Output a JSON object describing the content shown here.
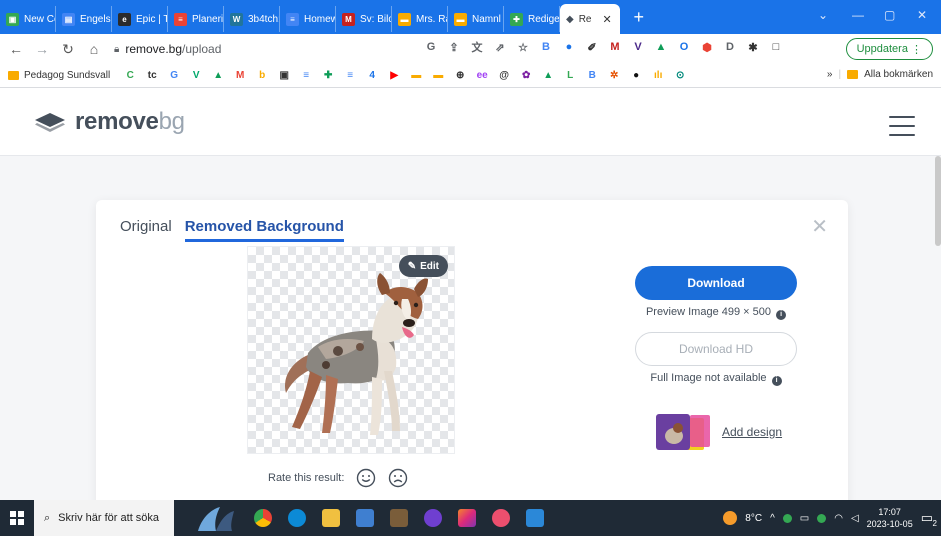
{
  "browser": {
    "tabs": [
      {
        "label": "New Co",
        "color": "#34a853",
        "glyph": "▣"
      },
      {
        "label": "Engelsk",
        "color": "#4285f4",
        "glyph": "▤"
      },
      {
        "label": "Epic | Ti",
        "color": "#2b2b2b",
        "glyph": "e"
      },
      {
        "label": "Planerir",
        "color": "#ea4335",
        "glyph": "≡"
      },
      {
        "label": "3b4tch:",
        "color": "#21759b",
        "glyph": "W"
      },
      {
        "label": "Homew",
        "color": "#4285f4",
        "glyph": "≡"
      },
      {
        "label": "Sv: Bild",
        "color": "#c5221f",
        "glyph": "M"
      },
      {
        "label": "Mrs. Ra",
        "color": "#f9ab00",
        "glyph": "▬"
      },
      {
        "label": "Namnl",
        "color": "#f9ab00",
        "glyph": "▬"
      },
      {
        "label": "Redige",
        "color": "#34a853",
        "glyph": "✚"
      }
    ],
    "active_tab": {
      "label": "Re"
    },
    "url_host": "remove.bg",
    "url_path": "/upload",
    "update_button": "Uppdatera",
    "extensions": [
      {
        "glyph": "G",
        "color": "#5f6368"
      },
      {
        "glyph": "⇪",
        "color": "#5f6368"
      },
      {
        "glyph": "文",
        "color": "#5f6368"
      },
      {
        "glyph": "⇗",
        "color": "#5f6368"
      },
      {
        "glyph": "☆",
        "color": "#5f6368"
      },
      {
        "glyph": "B",
        "color": "#4285f4"
      },
      {
        "glyph": "●",
        "color": "#1a73e8"
      },
      {
        "glyph": "✐",
        "color": "#333333"
      },
      {
        "glyph": "M",
        "color": "#c5221f"
      },
      {
        "glyph": "V",
        "color": "#4b2a8a"
      },
      {
        "glyph": "▲",
        "color": "#0f9d58"
      },
      {
        "glyph": "O",
        "color": "#1a73e8"
      },
      {
        "glyph": "⬢",
        "color": "#ea4335"
      },
      {
        "glyph": "D",
        "color": "#5f6368"
      },
      {
        "glyph": "✱",
        "color": "#333333"
      },
      {
        "glyph": "□",
        "color": "#333333"
      }
    ]
  },
  "bookmarks": {
    "first": "Pedagog Sundsvall",
    "icons": [
      {
        "glyph": "C",
        "color": "#34a853"
      },
      {
        "glyph": "tc",
        "color": "#333333"
      },
      {
        "glyph": "G",
        "color": "#4285f4"
      },
      {
        "glyph": "V",
        "color": "#00a86b"
      },
      {
        "glyph": "▲",
        "color": "#0f9d58"
      },
      {
        "glyph": "M",
        "color": "#ea4335"
      },
      {
        "glyph": "b",
        "color": "#f9ab00"
      },
      {
        "glyph": "▣",
        "color": "#333333"
      },
      {
        "glyph": "≡",
        "color": "#4285f4"
      },
      {
        "glyph": "✚",
        "color": "#0f9d58"
      },
      {
        "glyph": "≡",
        "color": "#4285f4"
      },
      {
        "glyph": "4",
        "color": "#1a73e8"
      },
      {
        "glyph": "▶",
        "color": "#ff0000"
      },
      {
        "glyph": "▬",
        "color": "#f9ab00"
      },
      {
        "glyph": "▬",
        "color": "#f9ab00"
      },
      {
        "glyph": "⊕",
        "color": "#333333"
      },
      {
        "glyph": "ee",
        "color": "#a142f4"
      },
      {
        "glyph": "@",
        "color": "#333333"
      },
      {
        "glyph": "✿",
        "color": "#7b1fa2"
      },
      {
        "glyph": "▲",
        "color": "#0f9d58"
      },
      {
        "glyph": "L",
        "color": "#34a853"
      },
      {
        "glyph": "B",
        "color": "#4285f4"
      },
      {
        "glyph": "✲",
        "color": "#e65100"
      },
      {
        "glyph": "●",
        "color": "#111111"
      },
      {
        "glyph": "ılı",
        "color": "#f9ab00"
      },
      {
        "glyph": "⊙",
        "color": "#00897b"
      }
    ],
    "more": "»",
    "all_bookmarks": "Alla bokmärken"
  },
  "site": {
    "logo_main": "remove",
    "logo_accent": "bg"
  },
  "card": {
    "tab_original": "Original",
    "tab_removed": "Removed Background",
    "edit_label": "Edit",
    "download_label": "Download",
    "preview_info": "Preview Image 499 × 500",
    "download_hd_label": "Download HD",
    "hd_info": "Full Image not available",
    "add_design": "Add design",
    "rate_label": "Rate this result:"
  },
  "taskbar": {
    "search_placeholder": "Skriv här för att söka",
    "temperature": "8°C",
    "time": "17:07",
    "date": "2023-10-05",
    "notification_count": "2"
  }
}
